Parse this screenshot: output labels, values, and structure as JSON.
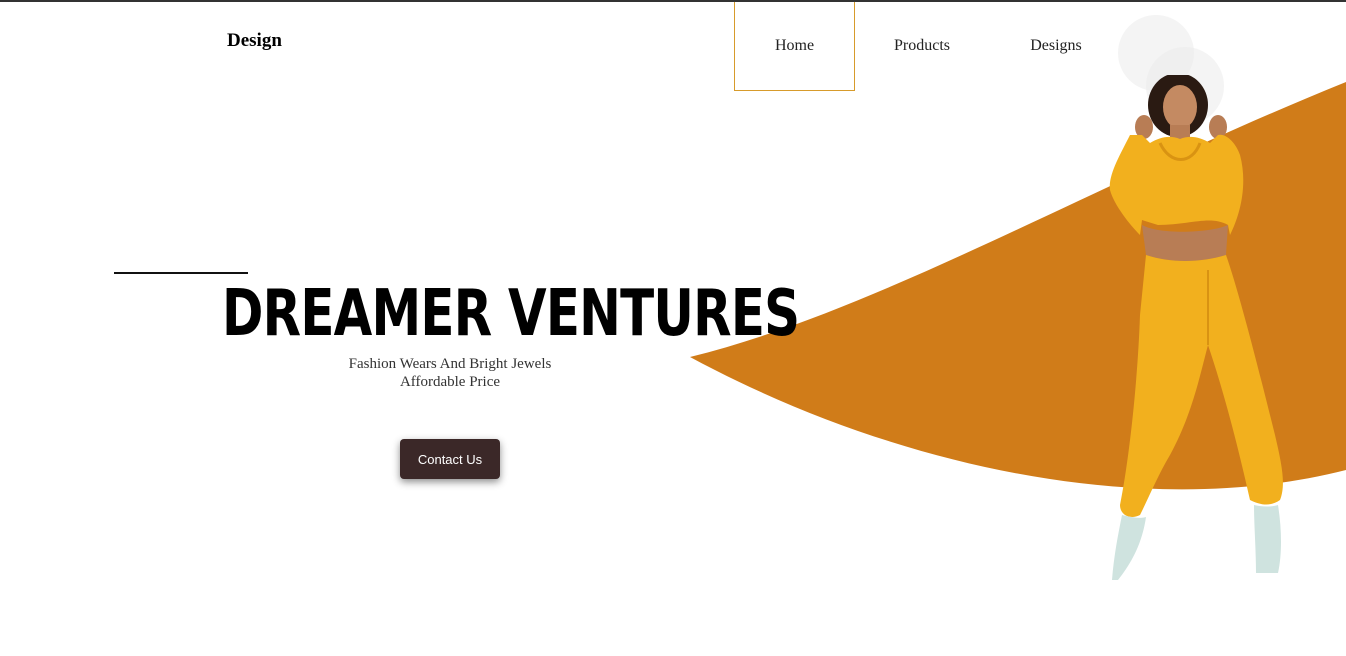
{
  "header": {
    "brand": "Design",
    "nav": [
      {
        "label": "Home",
        "active": true
      },
      {
        "label": "Products",
        "active": false
      },
      {
        "label": "Designs",
        "active": false
      }
    ]
  },
  "hero": {
    "title": "DREAMER VENTURES",
    "subtitle_line1": "Fashion Wears And Bright Jewels",
    "subtitle_line2": "Affordable Price",
    "cta_label": "Contact Us"
  },
  "colors": {
    "accent": "#d07c19",
    "nav_active_border": "#d79b2b",
    "button_bg": "#3b2828",
    "outfit": "#f2b01e"
  },
  "icons": {
    "hero_image": "model-in-yellow-tracksuit"
  }
}
